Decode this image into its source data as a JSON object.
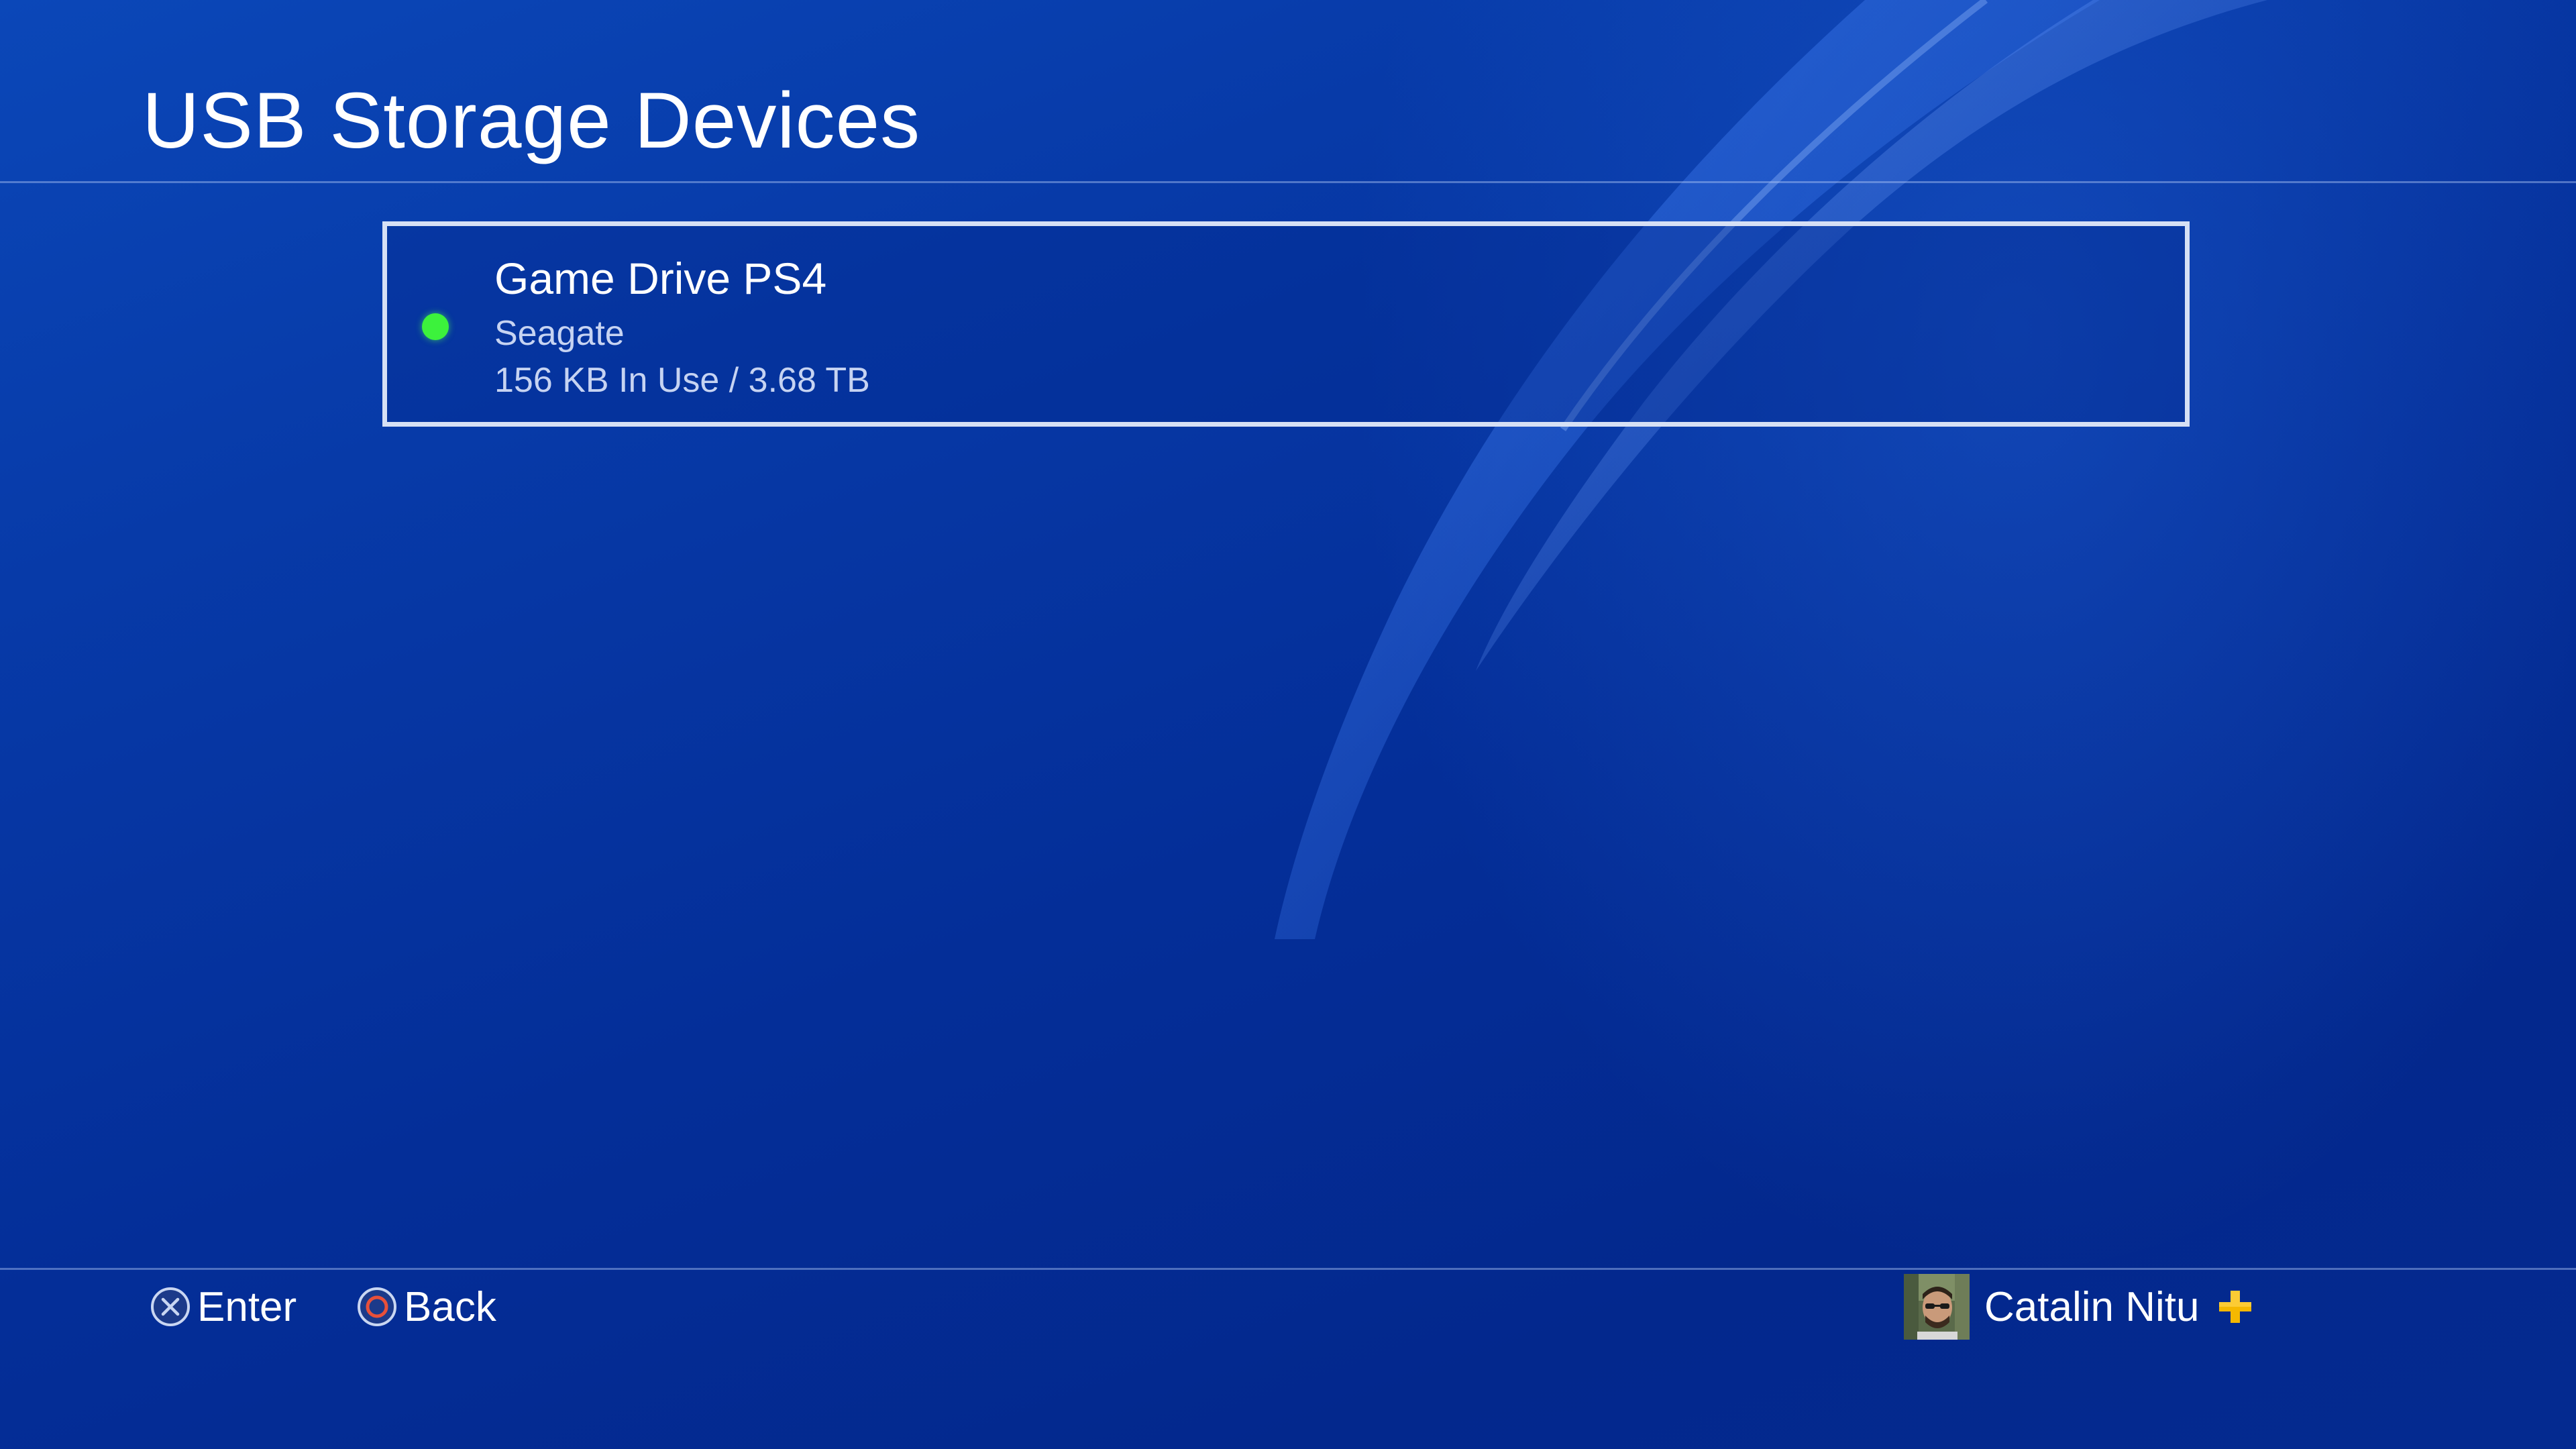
{
  "header": {
    "title": "USB Storage Devices"
  },
  "devices": [
    {
      "name": "Game Drive PS4",
      "brand": "Seagate",
      "usage": "156 KB In Use / 3.68 TB",
      "status_color": "#3cf23c"
    }
  ],
  "footer": {
    "hints": [
      {
        "icon": "cross-button-icon",
        "label": "Enter"
      },
      {
        "icon": "circle-button-icon",
        "label": "Back"
      }
    ],
    "user": {
      "name": "Catalin Nitu",
      "badge_icon": "playstation-plus-icon"
    }
  },
  "colors": {
    "background": "#0538a3",
    "focus_border": "#d6e0f5",
    "status_connected": "#3cf23c",
    "ps_plus": "#f5b800",
    "circle_button": "#e8503a"
  }
}
